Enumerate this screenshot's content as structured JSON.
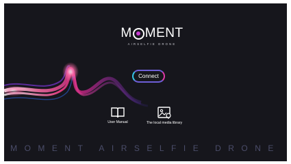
{
  "app": {
    "logo_word_pre": "M",
    "logo_word_post": "MENT",
    "logo_tagline": "AIRSELFIE DRONE"
  },
  "connect_button": {
    "label": "Connect"
  },
  "shortcuts": [
    {
      "label": "User Manual",
      "icon": "book-icon"
    },
    {
      "label": "The local media library",
      "icon": "gallery-icon"
    }
  ],
  "footer": {
    "text": "MOMENT AIRSELFIE DRONE"
  },
  "colors": {
    "background": "#16161c",
    "accent_cyan": "#35c7ea",
    "accent_magenta": "#e03aa8",
    "accent_violet": "#6e5fd8",
    "footer_text": "#4b4d6a"
  }
}
